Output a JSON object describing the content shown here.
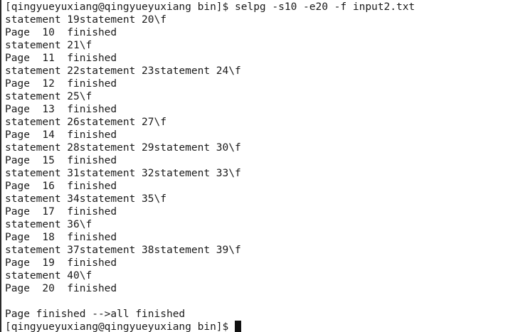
{
  "terminal": {
    "prompt_line": "[qingyueyuxiang@qingyueyuxiang bin]$ selpg -s10 -e20 -f input2.txt",
    "output_lines": [
      "statement 19statement 20\\f",
      "Page  10  finished",
      "statement 21\\f",
      "Page  11  finished",
      "statement 22statement 23statement 24\\f",
      "Page  12  finished",
      "statement 25\\f",
      "Page  13  finished",
      "statement 26statement 27\\f",
      "Page  14  finished",
      "statement 28statement 29statement 30\\f",
      "Page  15  finished",
      "statement 31statement 32statement 33\\f",
      "Page  16  finished",
      "statement 34statement 35\\f",
      "Page  17  finished",
      "statement 36\\f",
      "Page  18  finished",
      "statement 37statement 38statement 39\\f",
      "Page  19  finished",
      "statement 40\\f",
      "Page  20  finished",
      "",
      "Page finished -->all finished"
    ],
    "final_prompt": "[qingyueyuxiang@qingyueyuxiang bin]$ "
  }
}
